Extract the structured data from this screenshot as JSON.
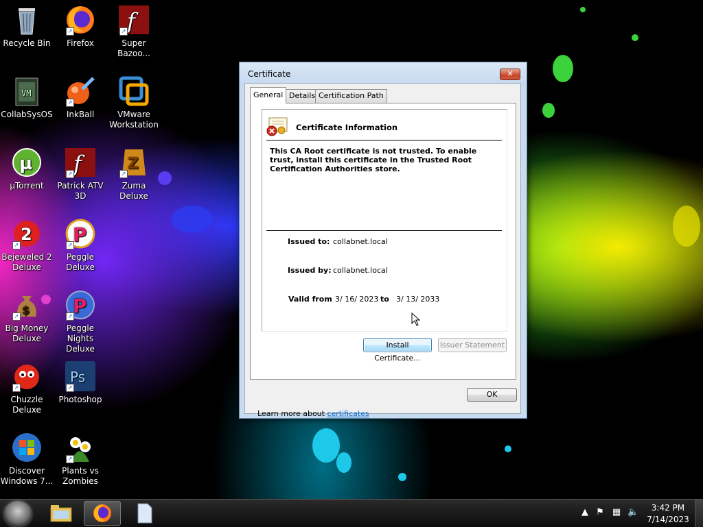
{
  "desktop": {
    "icons": [
      {
        "label": "Recycle Bin",
        "icon": "recycle-bin-icon"
      },
      {
        "label": "Firefox",
        "icon": "firefox-icon"
      },
      {
        "label": "Super Bazoo...",
        "icon": "flash-icon"
      },
      {
        "label": "CollabSysOS",
        "icon": "collabsysos-icon"
      },
      {
        "label": "InkBall",
        "icon": "inkball-icon"
      },
      {
        "label": "VMware Workstation",
        "icon": "vmware-icon"
      },
      {
        "label": "µTorrent",
        "icon": "utorrent-icon"
      },
      {
        "label": "Patrick ATV 3D",
        "icon": "flash-icon"
      },
      {
        "label": "Zuma Deluxe",
        "icon": "zuma-icon"
      },
      {
        "label": "Bejeweled 2 Deluxe",
        "icon": "bejeweled-icon"
      },
      {
        "label": "Peggle Deluxe",
        "icon": "peggle-icon"
      },
      {
        "label": "Big Money Deluxe",
        "icon": "money-bag-icon"
      },
      {
        "label": "Peggle Nights Deluxe",
        "icon": "peggle-nights-icon"
      },
      {
        "label": "Chuzzle Deluxe",
        "icon": "chuzzle-icon"
      },
      {
        "label": "Photoshop",
        "icon": "photoshop-icon"
      },
      {
        "label": "Discover Windows 7...",
        "icon": "windows-logo-icon"
      },
      {
        "label": "Plants vs Zombies",
        "icon": "plants-vs-zombies-icon"
      }
    ]
  },
  "dialog": {
    "title": "Certificate",
    "close_glyph": "✕",
    "tabs": [
      {
        "label": "General",
        "active": true
      },
      {
        "label": "Details",
        "active": false
      },
      {
        "label": "Certification Path",
        "active": false
      }
    ],
    "info_heading": "Certificate Information",
    "warning": "This CA Root certificate is not trusted. To enable trust, install this certificate in the Trusted Root Certification Authorities store.",
    "issued_to_label": "Issued to:",
    "issued_to_value": "collabnet.local",
    "issued_by_label": "Issued by:",
    "issued_by_value": "collabnet.local",
    "valid_from_label": "Valid from",
    "valid_from_value": "3/ 16/ 2023",
    "valid_to_label": "to",
    "valid_to_value": "3/ 13/ 2033",
    "install_button": "Install Certificate...",
    "issuer_button": "Issuer Statement",
    "learn_more_prefix": "Learn more about ",
    "learn_more_link": "certificates",
    "ok_button": "OK"
  },
  "taskbar": {
    "time": "3:42 PM",
    "date": "7/14/2023",
    "pinned": [
      {
        "name": "file-explorer-icon"
      },
      {
        "name": "firefox-icon"
      },
      {
        "name": "document-icon"
      }
    ]
  },
  "colors": {
    "dialog_frame": "#c9dcef",
    "link": "#0066cc",
    "close_button": "#c7452a"
  }
}
